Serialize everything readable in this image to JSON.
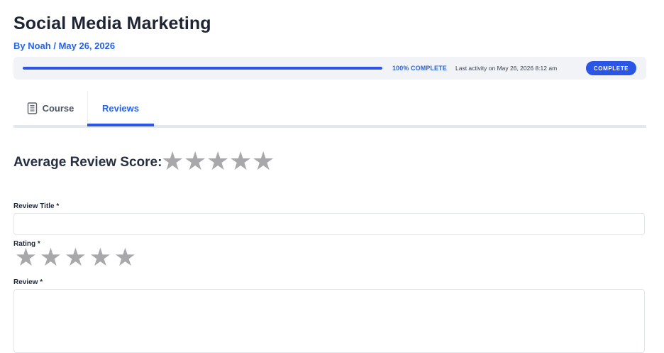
{
  "course": {
    "title": "Social Media Marketing",
    "byline": "By Noah / May 26, 2026"
  },
  "progress": {
    "percent": 100,
    "status_text": "100% COMPLETE",
    "last_activity": "Last activity on May 26, 2026 8:12 am",
    "badge": "COMPLETE",
    "accent_color": "#2a55e5"
  },
  "tabs": [
    {
      "label": "Course",
      "icon": "document-icon",
      "active": false
    },
    {
      "label": "Reviews",
      "active": true
    }
  ],
  "reviews": {
    "average_heading": "Average Review Score:",
    "average_stars": [
      "★",
      "★",
      "★",
      "★",
      "★"
    ],
    "star_color": "#a8a8ab"
  },
  "form": {
    "title_label": "Review Title *",
    "title_value": "",
    "rating_label": "Rating *",
    "rating_stars": [
      "★",
      "★",
      "★",
      "★",
      "★"
    ],
    "review_label": "Review *",
    "review_value": ""
  }
}
